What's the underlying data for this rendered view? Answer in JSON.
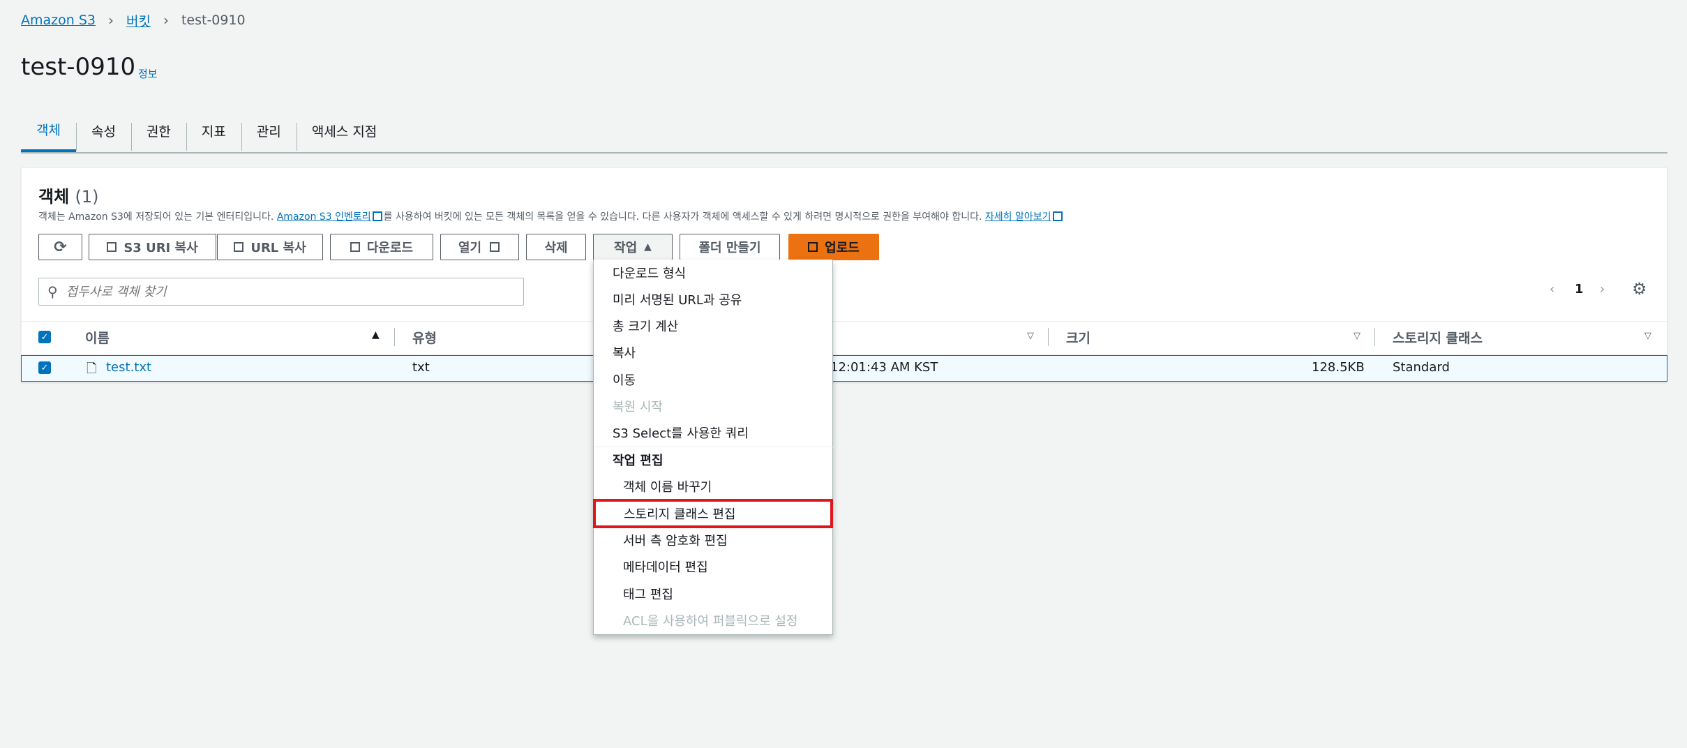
{
  "breadcrumb": {
    "root": "Amazon S3",
    "buckets": "버킷",
    "current": "test-0910"
  },
  "page": {
    "title": "test-0910",
    "info_link": "정보"
  },
  "tabs": [
    "객체",
    "속성",
    "권한",
    "지표",
    "관리",
    "액세스 지점"
  ],
  "objects": {
    "title": "객체",
    "count": "(1)",
    "desc_pre": "객체는 Amazon S3에 저장되어 있는 기본 엔터티입니다.",
    "inventory_link": "Amazon S3 인벤토리",
    "desc_mid": "를 사용하여 버킷에 있는 모든 객체의 목록을 얻을 수 있습니다. 다른 사용자가 객체에 액세스할 수 있게 하려면 명시적으로 권한을 부여해야 합니다.",
    "learn_more": "자세히 알아보기"
  },
  "toolbar": {
    "copy_s3_uri": "S3 URI 복사",
    "copy_url": "URL 복사",
    "download": "다운로드",
    "open": "열기",
    "delete": "삭제",
    "actions": "작업",
    "create_folder": "폴더 만들기",
    "upload": "업로드"
  },
  "search": {
    "placeholder": "접두사로 객체 찾기"
  },
  "pagination": {
    "page": "1"
  },
  "table": {
    "headers": {
      "name": "이름",
      "type": "유형",
      "size": "크기",
      "storage_class": "스토리지 클래스"
    },
    "rows": [
      {
        "name": "test.txt",
        "type": "txt",
        "modified": "12:01:43 AM KST",
        "size": "128.5KB",
        "storage_class": "Standard"
      }
    ]
  },
  "actions_menu": {
    "items": [
      "다운로드 형식",
      "미리 서명된 URL과 공유",
      "총 크기 계산",
      "복사",
      "이동",
      "복원 시작",
      "S3 Select를 사용한 쿼리",
      "작업 편집",
      "객체 이름 바꾸기",
      "스토리지 클래스 편집",
      "서버 측 암호화 편집",
      "메타데이터 편집",
      "태그 편집",
      "ACL을 사용하여 퍼블릭으로 설정"
    ]
  },
  "colors": {
    "accent": "#0073bb",
    "primary": "#ec7211",
    "highlight": "#e0161c"
  }
}
